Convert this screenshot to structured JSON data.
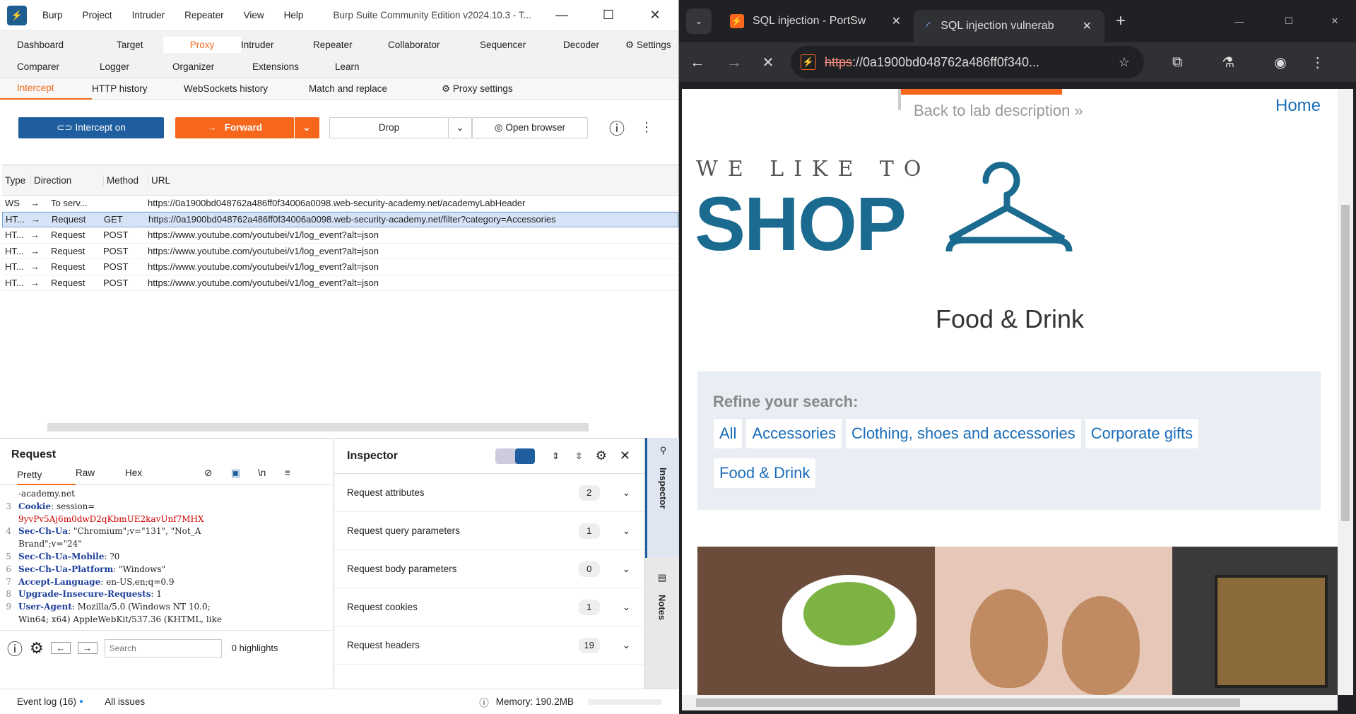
{
  "burp": {
    "title": "Burp Suite Community Edition v2024.10.3 - T...",
    "menu": [
      "Burp",
      "Project",
      "Intruder",
      "Repeater",
      "View",
      "Help"
    ],
    "tabs_row1": [
      "Dashboard",
      "Target",
      "Proxy",
      "Intruder",
      "Repeater",
      "Collaborator",
      "Sequencer",
      "Decoder"
    ],
    "settings_label": "Settings",
    "tabs_row2": [
      "Comparer",
      "Logger",
      "Organizer",
      "Extensions",
      "Learn"
    ],
    "proxy_subtabs": [
      "Intercept",
      "HTTP history",
      "WebSockets history",
      "Match and replace"
    ],
    "proxy_settings": "Proxy settings",
    "intercept_btn": "Intercept on",
    "forward_btn": "Forward",
    "drop_btn": "Drop",
    "open_browser_btn": "Open browser",
    "table_headers": [
      "Type",
      "Direction",
      "Method",
      "URL"
    ],
    "table_rows": [
      {
        "type": "WS",
        "dir": "To serv...",
        "method": "",
        "url": "https://0a1900bd048762a486ff0f34006a0098.web-security-academy.net/academyLabHeader"
      },
      {
        "type": "HT...",
        "dir": "Request",
        "method": "GET",
        "url": "https://0a1900bd048762a486ff0f34006a0098.web-security-academy.net/filter?category=Accessories"
      },
      {
        "type": "HT...",
        "dir": "Request",
        "method": "POST",
        "url": "https://www.youtube.com/youtubei/v1/log_event?alt=json"
      },
      {
        "type": "HT...",
        "dir": "Request",
        "method": "POST",
        "url": "https://www.youtube.com/youtubei/v1/log_event?alt=json"
      },
      {
        "type": "HT...",
        "dir": "Request",
        "method": "POST",
        "url": "https://www.youtube.com/youtubei/v1/log_event?alt=json"
      },
      {
        "type": "HT...",
        "dir": "Request",
        "method": "POST",
        "url": "https://www.youtube.com/youtubei/v1/log_event?alt=json"
      }
    ],
    "request_title": "Request",
    "request_tabs": [
      "Pretty",
      "Raw",
      "Hex"
    ],
    "newline_label": "\\n",
    "code_lines": [
      {
        "n": "",
        "k": "",
        "v": "-academy.net"
      },
      {
        "n": "3",
        "k": "Cookie",
        "v": " session="
      },
      {
        "n": "",
        "k": "",
        "v": "9yvPv5Aj6m0dwD2qKbmUE2kavUnf7MHX",
        "red": true
      },
      {
        "n": "4",
        "k": "Sec-Ch-Ua",
        "v": " \"Chromium\";v=\"131\", \"Not_A"
      },
      {
        "n": "",
        "k": "",
        "v": "Brand\";v=\"24\""
      },
      {
        "n": "5",
        "k": "Sec-Ch-Ua-Mobile",
        "v": " ?0"
      },
      {
        "n": "6",
        "k": "Sec-Ch-Ua-Platform",
        "v": " \"Windows\""
      },
      {
        "n": "7",
        "k": "Accept-Language",
        "v": " en-US,en;q=0.9"
      },
      {
        "n": "8",
        "k": "Upgrade-Insecure-Requests",
        "v": " 1"
      },
      {
        "n": "9",
        "k": "User-Agent",
        "v": " Mozilla/5.0 (Windows NT 10.0;"
      },
      {
        "n": "",
        "k": "",
        "v": "Win64; x64) AppleWebKit/537.36 (KHTML, like"
      }
    ],
    "search_placeholder": "Search",
    "highlights": "0 highlights",
    "inspector_title": "Inspector",
    "inspector_rows": [
      {
        "label": "Request attributes",
        "count": "2"
      },
      {
        "label": "Request query parameters",
        "count": "1"
      },
      {
        "label": "Request body parameters",
        "count": "0"
      },
      {
        "label": "Request cookies",
        "count": "1"
      },
      {
        "label": "Request headers",
        "count": "19"
      }
    ],
    "side_inspector": "Inspector",
    "side_notes": "Notes",
    "event_log": "Event log (16)",
    "all_issues": "All issues",
    "memory": "Memory: 190.2MB"
  },
  "chrome": {
    "tab1": "SQL injection - PortSw",
    "tab2": "SQL injection vulnerab",
    "url_scheme": "https",
    "url_rest": "://0a1900bd048762a486ff0f340..."
  },
  "page": {
    "back_link": "Back to lab description",
    "home": "Home",
    "tagline": "WE LIKE TO",
    "shop": "SHOP",
    "heading": "Food & Drink",
    "refine": "Refine your search:",
    "filters_row1": [
      "All",
      "Accessories",
      "Clothing, shoes and accessories",
      "Corporate gifts"
    ],
    "filters_row2": [
      "Food & Drink"
    ]
  },
  "colors": {
    "burp_orange": "#f6661b",
    "burp_blue": "#1f5e9e",
    "shop_blue": "#1a6b8f",
    "link_blue": "#1a6cb8"
  }
}
